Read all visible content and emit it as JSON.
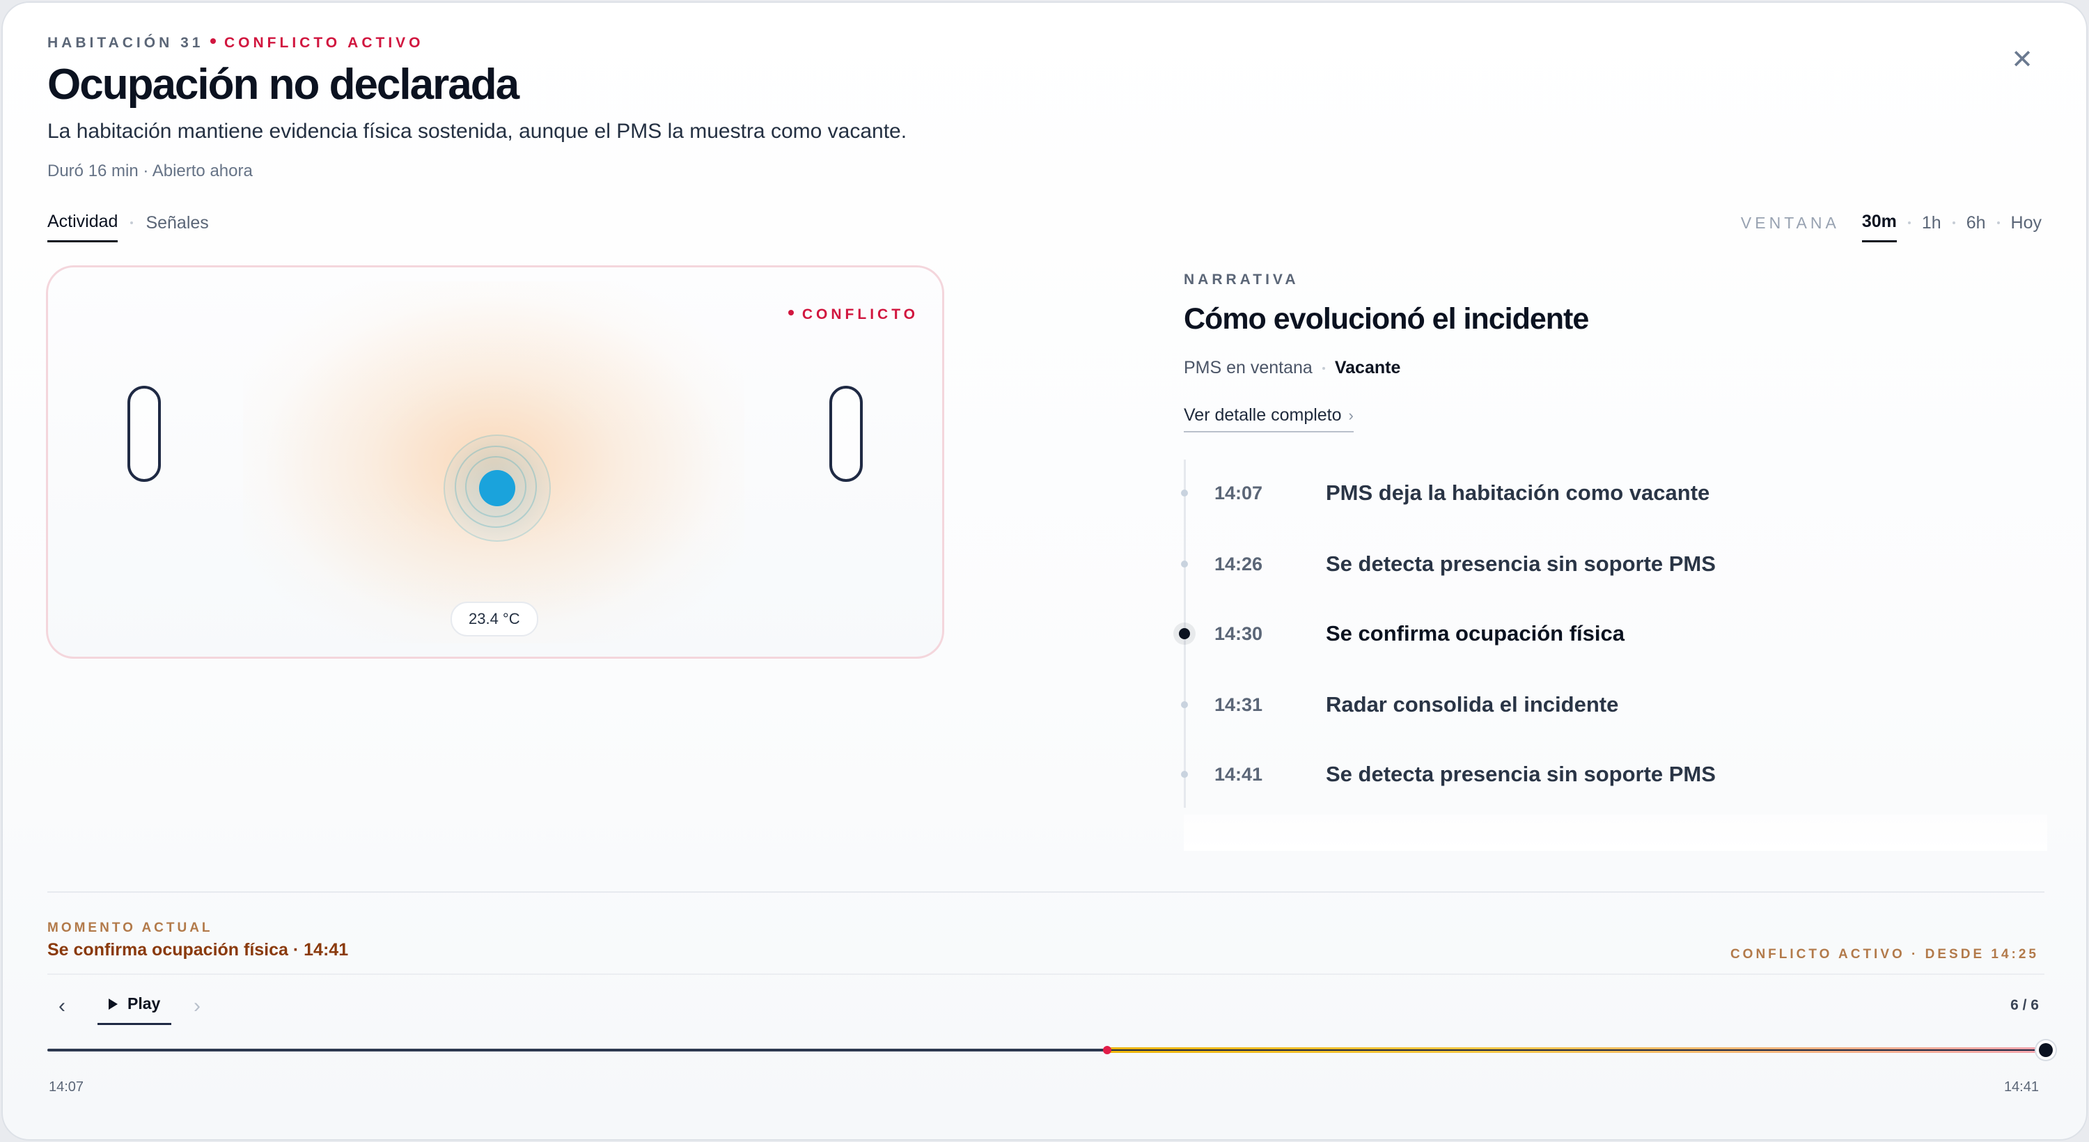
{
  "header": {
    "room": "HABITACIÓN 31",
    "status": "CONFLICTO ACTIVO",
    "title": "Ocupación no declarada",
    "subtitle": "La habitación mantiene evidencia física sostenida, aunque el PMS la muestra como vacante.",
    "meta": "Duró 16 min · Abierto ahora",
    "close_icon": "close-icon"
  },
  "tabs": [
    {
      "label": "Actividad",
      "active": true
    },
    {
      "label": "Señales",
      "active": false
    }
  ],
  "window": {
    "label": "VENTANA",
    "options": [
      {
        "label": "30m",
        "active": true
      },
      {
        "label": "1h",
        "active": false
      },
      {
        "label": "6h",
        "active": false
      },
      {
        "label": "Hoy",
        "active": false
      }
    ]
  },
  "room_view": {
    "badge": "CONFLICTO",
    "temperature": "23.4 °C"
  },
  "narrative": {
    "eyebrow": "NARRATIVA",
    "title": "Cómo evolucionó el incidente",
    "pms_label": "PMS en ventana",
    "pms_value": "Vacante",
    "detail_link": "Ver detalle completo",
    "events": [
      {
        "time": "14:07",
        "text": "PMS deja la habitación como vacante",
        "active": false
      },
      {
        "time": "14:26",
        "text": "Se detecta presencia sin soporte PMS",
        "active": false
      },
      {
        "time": "14:30",
        "text": "Se confirma ocupación física",
        "active": true
      },
      {
        "time": "14:31",
        "text": "Radar consolida el incidente",
        "active": false
      },
      {
        "time": "14:41",
        "text": "Se detecta presencia sin soporte PMS",
        "active": false
      }
    ]
  },
  "moment": {
    "eyebrow": "MOMENTO ACTUAL",
    "text": "Se confirma ocupación física · 14:41",
    "since": "CONFLICTO ACTIVO · DESDE 14:25"
  },
  "playback": {
    "prev_icon": "chevron-left-icon",
    "play_label": "Play",
    "next_icon": "chevron-right-icon",
    "counter": "6 / 6",
    "start_time": "14:07",
    "end_time": "14:41",
    "conflict_start_fraction": 0.53,
    "position_fraction": 1.0
  },
  "colors": {
    "conflict": "#d1163f",
    "accent_presence": "#1aa3dc",
    "moment_text": "#8a3a0c"
  }
}
